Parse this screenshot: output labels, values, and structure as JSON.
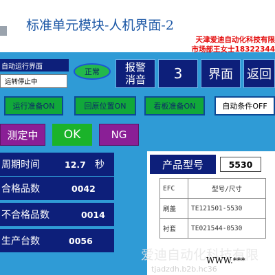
{
  "header": {
    "title": "标准单元模块-人机界面-2",
    "promo_line1": "天津爱迪自动化科技有限",
    "promo_line2": "市场部王女士18322344"
  },
  "top_row": {
    "mode_label": "自动运行界面",
    "status_text": "运转停止中",
    "normal_label": "正常",
    "alarm_mute_line1": "报警",
    "alarm_mute_line2": "消音",
    "screen_number": "3",
    "screen_label": "界面",
    "back_label": "返回"
  },
  "second_row": {
    "run_ready": "运行准备ON",
    "origin_position": "回原位置ON",
    "board_ready": "看板准备ON",
    "auto_condition": "自动条件OFF"
  },
  "test_row": {
    "measuring": "测定中",
    "ok": "OK",
    "ng": "NG"
  },
  "stats": {
    "cycle_time_label": "周期时间",
    "cycle_time_value": "12.7",
    "cycle_time_unit": "秒",
    "pass_label": "合格品数",
    "pass_value": "0042",
    "fail_label": "不合格品数",
    "fail_value": "0014",
    "produced_label": "生产台数",
    "produced_value": "0056"
  },
  "product": {
    "model_label": "产品型号",
    "model_value": "5530",
    "table_header": [
      "EFC",
      "型号/尺寸"
    ],
    "rows": [
      [
        "刷盖",
        "TE121501-5530"
      ],
      [
        "衬套",
        "TE021544-0530"
      ]
    ]
  },
  "footer": {
    "watermark": "爱迪自动化科技有限",
    "www": "WWW.***",
    "site": "tjadzdh.b2b.hc36"
  },
  "colors": {
    "background": "#2f9bd6",
    "panel": "#0d1f7a",
    "green": "#11a83a",
    "purple": "#8a1f96",
    "title": "#1d58a6",
    "promo_red": "#e40d0d"
  }
}
